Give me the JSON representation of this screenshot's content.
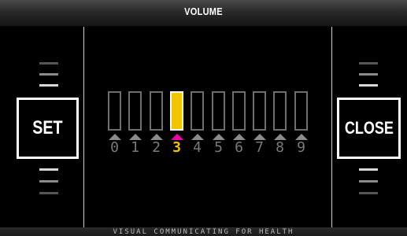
{
  "header": {
    "title": "VOLUME"
  },
  "footer": {
    "text": "VISUAL COMMUNICATING FOR HEALTH"
  },
  "buttons": {
    "set_label": "SET",
    "close_label": "CLOSE"
  },
  "volume": {
    "level": 3,
    "levels": [
      "0",
      "1",
      "2",
      "3",
      "4",
      "5",
      "6",
      "7",
      "8",
      "9"
    ]
  },
  "colors": {
    "active_bar": "#f2c500",
    "active_arrow": "#ee00aa",
    "inactive": "#6e6e6e"
  }
}
